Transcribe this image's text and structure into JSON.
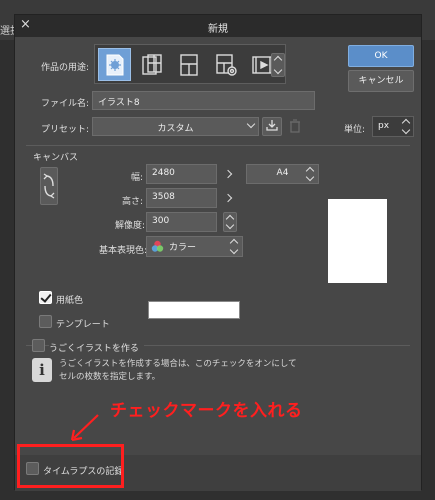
{
  "background": {
    "tab_label": "選択"
  },
  "dialog": {
    "title": "新規",
    "close_glyph": "×",
    "ok_label": "OK",
    "cancel_label": "キャンセル",
    "use_label": "作品の用途:",
    "use_icons": [
      "illustration-icon",
      "comic-icon",
      "page-icon",
      "settings-page-icon",
      "animation-icon"
    ],
    "filename_label": "ファイル名:",
    "filename_value": "イラスト8",
    "preset_label": "プリセット:",
    "preset_value": "カスタム",
    "unit_label": "単位:",
    "unit_value": "px"
  },
  "canvas": {
    "section_title": "キャンバス",
    "width_label": "幅:",
    "width_value": "2480",
    "height_label": "高さ:",
    "height_value": "3508",
    "resolution_label": "解像度:",
    "resolution_value": "300",
    "color_label": "基本表現色:",
    "color_value": "カラー",
    "size_preset_value": "A4"
  },
  "paper": {
    "paper_color_label": "用紙色",
    "paper_color_checked": true,
    "paper_color_hex": "#ffffff",
    "template_label": "テンプレート",
    "template_checked": false
  },
  "animation": {
    "label": "うごくイラストを作る",
    "checked": false,
    "info_line1": "うごくイラストを作成する場合は、このチェックをオンにして",
    "info_line2": "セルの枚数を指定します。"
  },
  "timelapse": {
    "label": "タイムラプスの記録",
    "checked": false
  },
  "annotation": {
    "text": "チェックマークを入れる",
    "color": "#ff1f1f"
  }
}
